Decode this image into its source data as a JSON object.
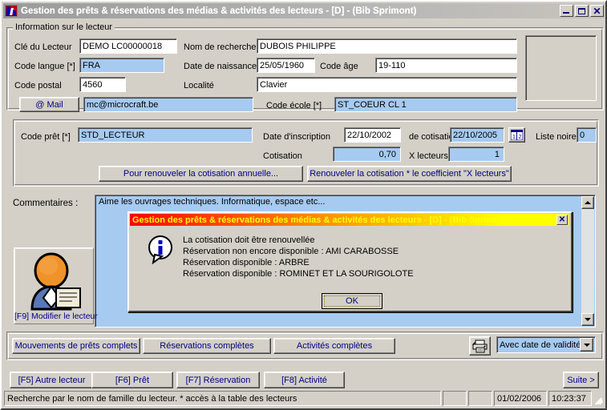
{
  "window": {
    "title": "Gestion des prêts & réservations des médias & activités des lecteurs - [D] - (Bib Sprimont)",
    "icon": "app-icon",
    "minimize_label": "_",
    "maximize_label": "□",
    "close_label": "✕"
  },
  "reader_group": {
    "legend": "Information sur le lecteur",
    "fields": {
      "cle_lecteur_label": "Clé du Lecteur",
      "cle_lecteur_value": "DEMO LC00000018",
      "nom_recherche_label": "Nom de recherche",
      "nom_recherche_value": "DUBOIS PHILIPPE",
      "code_langue_label": "Code langue [*]",
      "code_langue_value": "FRA",
      "date_naissance_label": "Date de naissance",
      "date_naissance_value": "25/05/1960",
      "code_age_label": "Code âge",
      "code_age_value": "19-110",
      "code_postal_label": "Code postal",
      "code_postal_value": "4560",
      "localite_label": "Localité",
      "localite_value": "Clavier",
      "mail_button": "@ Mail",
      "mail_value": "mc@microcraft.be",
      "code_ecole_label": "Code école [*]",
      "code_ecole_value": "ST_COEUR CL 1"
    }
  },
  "loan_group": {
    "code_pret_label": "Code prêt [*]",
    "code_pret_value": "STD_LECTEUR",
    "date_inscription_label": "Date d'inscription",
    "date_inscription_value": "22/10/2002",
    "de_cotisation_label": "de cotisation",
    "de_cotisation_value": "22/10/2005",
    "calendar_icon": "calendar-icon",
    "liste_noire_label": "Liste noire",
    "liste_noire_value": "0",
    "cotisation_label": "Cotisation",
    "cotisation_value": "0,70",
    "x_lecteurs_label": "X lecteurs",
    "x_lecteurs_value": "1",
    "renew_annual_button": "Pour renouveler la cotisation annuelle...",
    "renew_coeff_button": "Renouveler la cotisation * le coefficient \"X lecteurs\""
  },
  "comments": {
    "label": "Commentaires :",
    "text": "Aime les ouvrages techniques. Informatique, espace etc...",
    "scroll_up_icon": "scroll-up-arrow",
    "scroll_down_icon": "scroll-down-arrow"
  },
  "avatar": {
    "icon": "user-document-icon",
    "label": "[F9] Modifier le lecteur"
  },
  "action_buttons": {
    "mouvements": "Mouvements de prêts complets",
    "reservations": "Réservations complètes",
    "activites": "Activités complètes",
    "print_icon": "printer-icon",
    "combo_value": "Avec date de validité",
    "combo_arrow_icon": "chevron-down-icon"
  },
  "function_buttons": {
    "f5": "[F5] Autre lecteur",
    "f6": "[F6] Prêt",
    "f7": "[F7] Réservation",
    "f8": "[F8] Activité",
    "suite": "Suite >"
  },
  "statusbar": {
    "message": "Recherche par le nom de famille du lecteur. * accès à la table des lecteurs",
    "panel2": "",
    "panel3": "",
    "date": "01/02/2006",
    "time": "10:23:37"
  },
  "dialog": {
    "title": "Gestion des prêts & réservations des médias & activités des lecteurs - [D] - (Bib Sprimont)",
    "close_label": "✕",
    "icon": "info-icon",
    "line1": "La cotisation doit être renouvellée",
    "line2": "Réservation non encore disponible : AMI CARABOSSE",
    "line3": "Réservation disponible : ARBRE",
    "line4": "Réservation disponible : ROMINET ET LA SOURIGOLOTE",
    "ok_label": "OK"
  },
  "colors": {
    "window_face": "#d4d0c8",
    "highlight_field": "#a6caf0",
    "button_text": "#000080",
    "dialog_title_start": "#ff0000",
    "dialog_title_end": "#ffff00",
    "dialog_title_text": "#ffff00"
  }
}
